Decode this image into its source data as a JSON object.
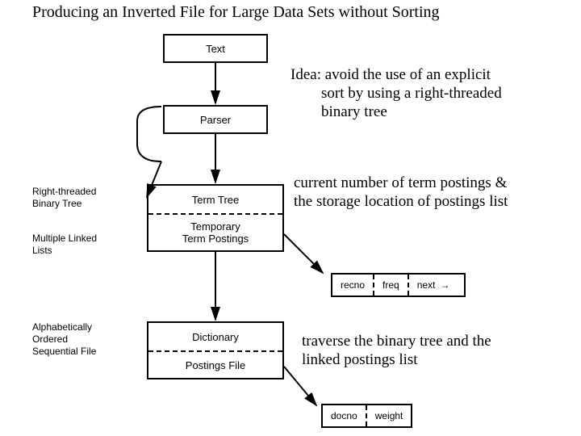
{
  "title": "Producing an Inverted File for Large Data Sets without Sorting",
  "boxes": {
    "text": "Text",
    "parser": "Parser",
    "termtree": {
      "upper": "Term Tree",
      "lower": "Temporary\nTerm Postings"
    },
    "output": {
      "upper": "Dictionary",
      "lower": "Postings File"
    }
  },
  "side_labels": {
    "rtbt": "Right-threaded\nBinary Tree",
    "mll": "Multiple Linked\nLists",
    "aosf": "Alphabetically\nOrdered\nSequential File"
  },
  "records": {
    "posting": {
      "c1": "recno",
      "c2": "freq",
      "c3": "next"
    },
    "docwt": {
      "c1": "docno",
      "c2": "weight"
    }
  },
  "annotations": {
    "idea": "Idea: avoid the use of an explicit\n        sort by using a right-threaded\n        binary tree",
    "current": "current number of term postings &\nthe storage location of postings list",
    "traverse": "traverse the binary tree and the\nlinked postings list"
  }
}
